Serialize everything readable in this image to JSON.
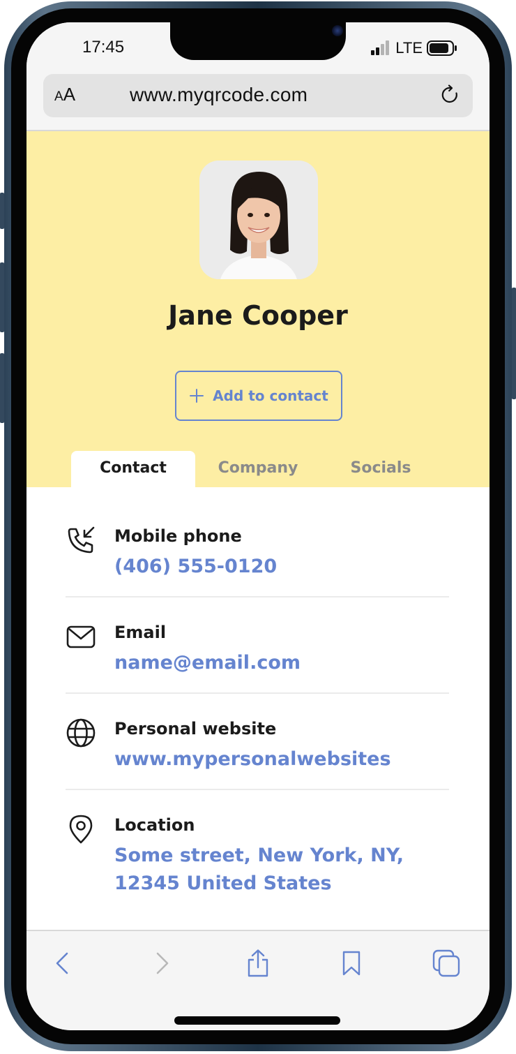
{
  "status_bar": {
    "time": "17:45",
    "network": "LTE",
    "icons": [
      "signal-bars-icon",
      "battery-icon"
    ]
  },
  "browser": {
    "text_size_small": "A",
    "text_size_large": "A",
    "url": "www.myqrcode.com",
    "reload_icon": "reload-icon"
  },
  "profile": {
    "name": "Jane Cooper",
    "avatar": "profile-photo",
    "add_contact_label": "Add to contact"
  },
  "tabs": [
    {
      "label": "Contact",
      "active": true
    },
    {
      "label": "Company",
      "active": false
    },
    {
      "label": "Socials",
      "active": false
    }
  ],
  "contact": {
    "items": [
      {
        "icon": "phone-incoming-icon",
        "title": "Mobile phone",
        "value": "(406) 555-0120"
      },
      {
        "icon": "mail-icon",
        "title": "Email",
        "value": "name@email.com"
      },
      {
        "icon": "globe-icon",
        "title": "Personal website",
        "value": "www.mypersonalwebsites"
      },
      {
        "icon": "location-pin-icon",
        "title": "Location",
        "value_line1": "Some street, New York, NY,",
        "value_line2": "12345 United States"
      }
    ]
  },
  "toolbar": {
    "icons": [
      "back-chevron-icon",
      "forward-chevron-icon",
      "share-icon",
      "bookmark-icon",
      "tabs-icon"
    ]
  },
  "colors": {
    "hero_background": "#fdeea4",
    "accent": "#6584cf",
    "text_dark": "#1b1b1b",
    "tab_inactive": "#8a8a8a"
  }
}
